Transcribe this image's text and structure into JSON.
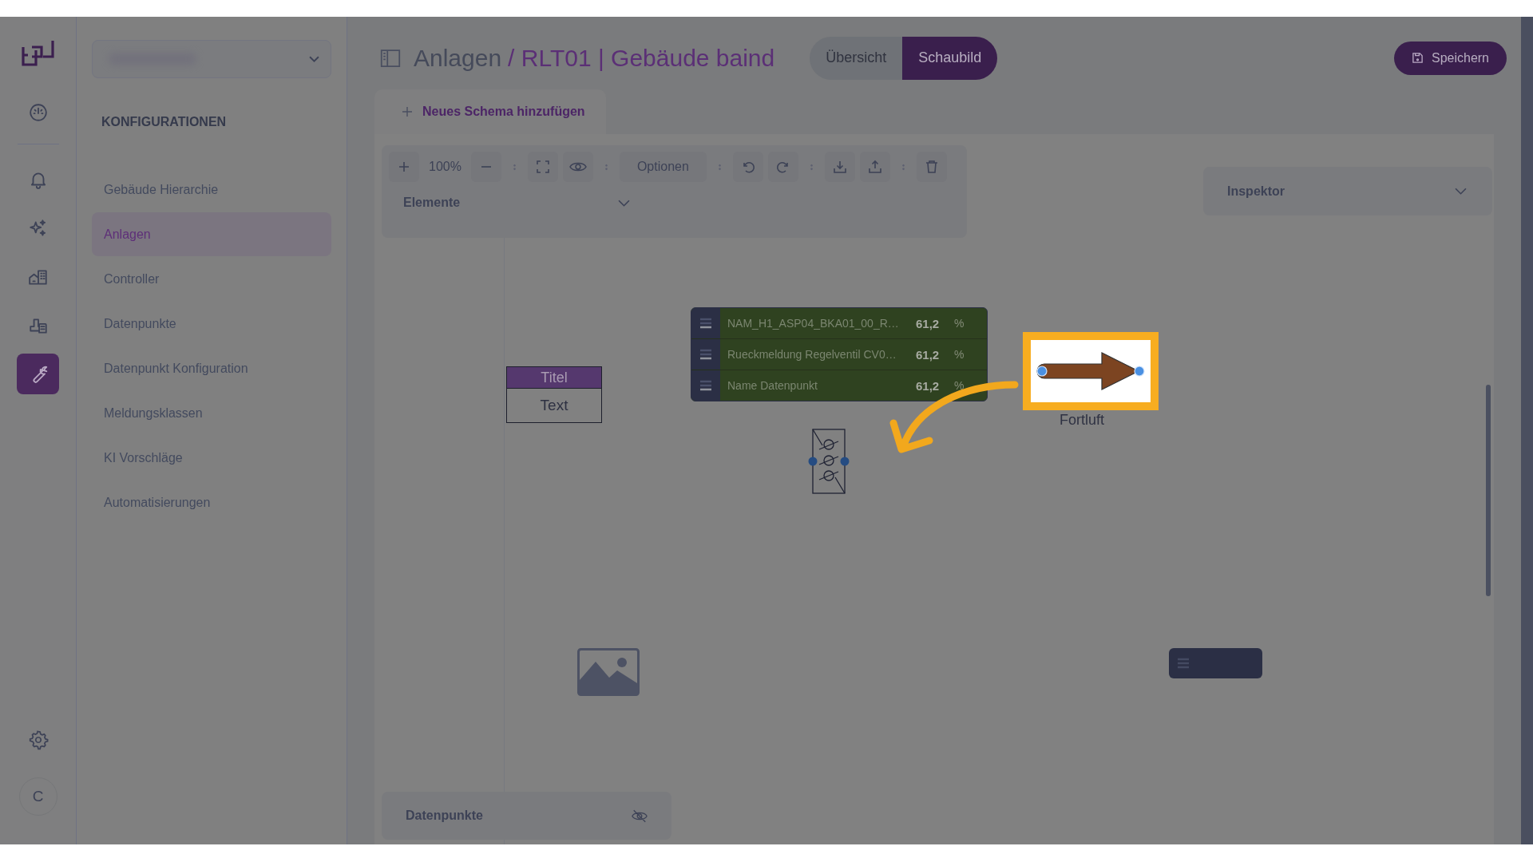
{
  "rail": {
    "items": [
      {
        "kind": "dashboard",
        "selected": false
      },
      {
        "kind": "bell",
        "selected": false
      },
      {
        "kind": "sparkle",
        "selected": false
      },
      {
        "kind": "buildings",
        "selected": false
      },
      {
        "kind": "plant",
        "selected": false
      },
      {
        "kind": "wrench",
        "selected": true
      }
    ],
    "avatar": "C"
  },
  "sidebar": {
    "heading": "KONFIGURATIONEN",
    "items": [
      {
        "label": "Gebäude Hierarchie",
        "selected": false
      },
      {
        "label": "Anlagen",
        "selected": true
      },
      {
        "label": "Controller",
        "selected": false
      },
      {
        "label": "Datenpunkte",
        "selected": false
      },
      {
        "label": "Datenpunkt Konfiguration",
        "selected": false
      },
      {
        "label": "Meldungsklassen",
        "selected": false
      },
      {
        "label": "KI Vorschläge",
        "selected": false
      },
      {
        "label": "Automatisierungen",
        "selected": false
      }
    ]
  },
  "header": {
    "breadcrumb": "Anlagen",
    "title": "/ RLT01 | Gebäude baind",
    "view_toggle": [
      {
        "label": "Übersicht",
        "selected": false
      },
      {
        "label": "Schaubild",
        "selected": true
      }
    ],
    "save_button": "Speichern"
  },
  "schema_tab": "Neues Schema hinzufügen",
  "toolbar": {
    "zoom": "100%",
    "options": "Optionen",
    "elements": "Elemente"
  },
  "inspector": "Inspektor",
  "canvas": {
    "text_block": {
      "title": "Titel",
      "text": "Text"
    },
    "datapoint_table": [
      {
        "name": "NAM_H1_ASP04_BKA01_00_R…",
        "value": "61,2",
        "unit": "%"
      },
      {
        "name": "Rueckmeldung Regelventil CV0…",
        "value": "61,2",
        "unit": "%"
      },
      {
        "name": "Name Datenpunkt",
        "value": "61,2",
        "unit": "%"
      }
    ],
    "arrow_label": "Fortluft"
  },
  "datapoints_panel": "Datenpunkte"
}
